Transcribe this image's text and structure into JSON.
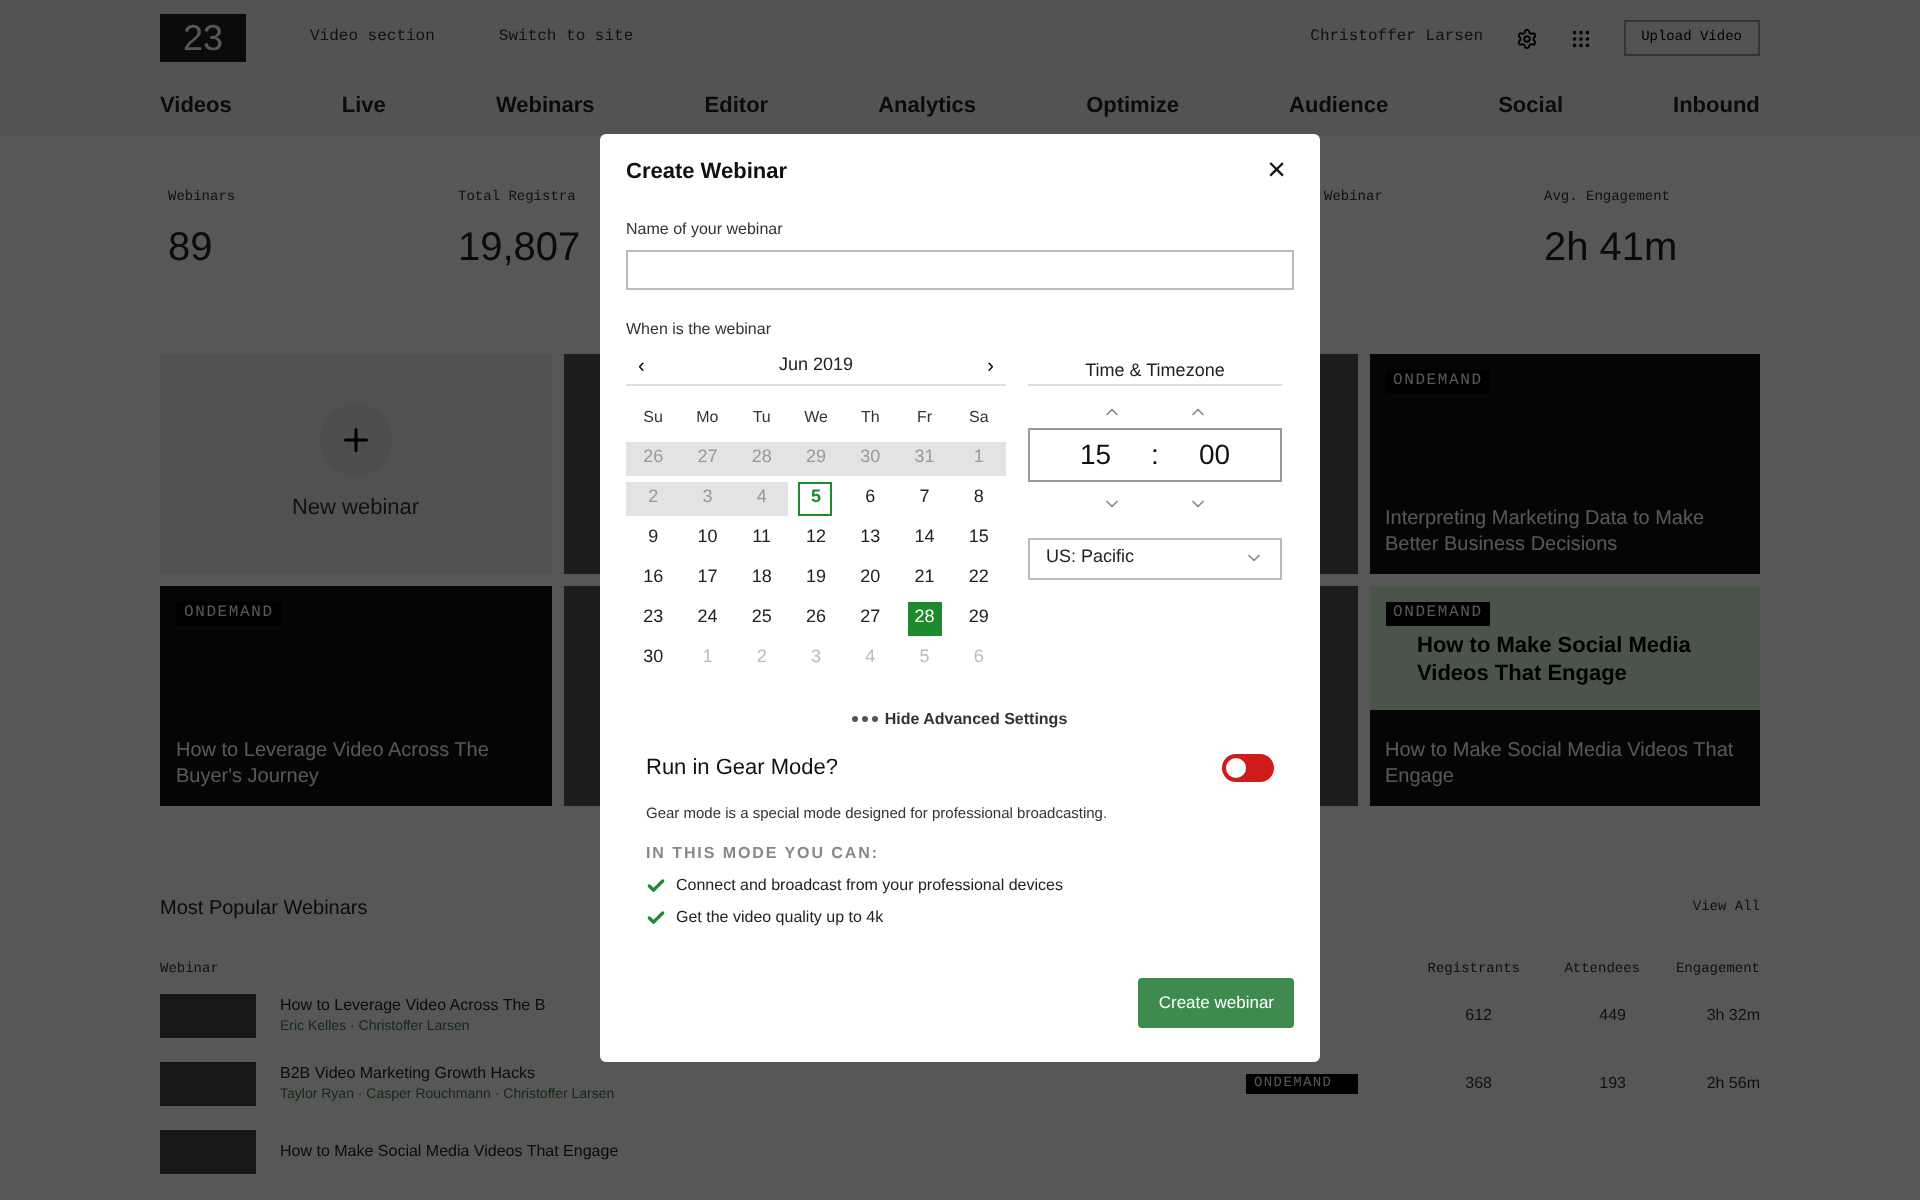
{
  "header": {
    "logo": "23",
    "links": [
      "Video section",
      "Switch to site"
    ],
    "user": "Christoffer Larsen",
    "upload": "Upload Video"
  },
  "nav": [
    "Videos",
    "Live",
    "Webinars",
    "Editor",
    "Analytics",
    "Optimize",
    "Audience",
    "Social",
    "Inbound"
  ],
  "stats": [
    {
      "label": "Webinars",
      "value": "89"
    },
    {
      "label": "Total Registra",
      "value": "19,807"
    },
    {
      "label": "Webinar"
    },
    {
      "label": "Avg. Engagement",
      "value": "2h 41m"
    }
  ],
  "cards": [
    {
      "kind": "new",
      "title": "New webinar"
    },
    {
      "kind": "hidden"
    },
    {
      "kind": "hidden"
    },
    {
      "kind": "video",
      "badge": "ONDEMAND",
      "title": "Interpreting Marketing Data to Make Better Business Decisions"
    },
    {
      "kind": "video",
      "badge": "ONDEMAND",
      "title": "How to Leverage Video Across The Buyer's Journey"
    },
    {
      "kind": "hidden"
    },
    {
      "kind": "hidden"
    },
    {
      "kind": "thumb",
      "badge": "ONDEMAND",
      "thumb_title": "How to Make Social Media Videos That Engage",
      "title": "How to Make Social Media Videos That Engage"
    }
  ],
  "popular": {
    "title": "Most Popular Webinars",
    "view_all": "View All",
    "columns": [
      "Webinar",
      "Registrants",
      "Attendees",
      "Engagement"
    ],
    "rows": [
      {
        "title": "How to Leverage Video Across The B",
        "authors": "Eric Kelles · Christoffer Larsen",
        "registrants": "612",
        "attendees": "449",
        "engagement": "3h 32m"
      },
      {
        "title": "B2B Video Marketing Growth Hacks",
        "authors": "Taylor Ryan · Casper Rouchmann · Christoffer Larsen",
        "badge": "ONDEMAND",
        "registrants": "368",
        "attendees": "193",
        "engagement": "2h 56m"
      },
      {
        "title": "How to Make Social Media Videos That Engage"
      }
    ]
  },
  "modal": {
    "title": "Create Webinar",
    "close": "×",
    "name_label": "Name of your webinar",
    "when_label": "When is the webinar",
    "calendar": {
      "prev": "‹",
      "month": "Jun 2019",
      "next": "›",
      "weekdays": [
        "Su",
        "Mo",
        "Tu",
        "We",
        "Th",
        "Fr",
        "Sa"
      ],
      "weeks": [
        [
          {
            "d": "26",
            "kind": "past",
            "selected": false
          },
          {
            "d": "27",
            "kind": "past",
            "selected": false
          },
          {
            "d": "28",
            "kind": "past",
            "selected": false
          },
          {
            "d": "29",
            "kind": "past",
            "selected": false
          },
          {
            "d": "30",
            "kind": "past",
            "selected": false
          },
          {
            "d": "31",
            "kind": "past",
            "selected": false
          },
          {
            "d": "1",
            "kind": "past",
            "selected": false
          }
        ],
        [
          {
            "d": "2",
            "kind": "past",
            "selected": false
          },
          {
            "d": "3",
            "kind": "past",
            "selected": false
          },
          {
            "d": "4",
            "kind": "past",
            "selected": false
          },
          {
            "d": "5",
            "kind": "today",
            "selected": false
          },
          {
            "d": "6",
            "kind": "day",
            "selected": false
          },
          {
            "d": "7",
            "kind": "day",
            "selected": false
          },
          {
            "d": "8",
            "kind": "day",
            "selected": false
          }
        ],
        [
          {
            "d": "9",
            "kind": "day",
            "selected": false
          },
          {
            "d": "10",
            "kind": "day",
            "selected": false
          },
          {
            "d": "11",
            "kind": "day",
            "selected": false
          },
          {
            "d": "12",
            "kind": "day",
            "selected": false
          },
          {
            "d": "13",
            "kind": "day",
            "selected": false
          },
          {
            "d": "14",
            "kind": "day",
            "selected": false
          },
          {
            "d": "15",
            "kind": "day",
            "selected": false
          }
        ],
        [
          {
            "d": "16",
            "kind": "day",
            "selected": false
          },
          {
            "d": "17",
            "kind": "day",
            "selected": false
          },
          {
            "d": "18",
            "kind": "day",
            "selected": false
          },
          {
            "d": "19",
            "kind": "day",
            "selected": false
          },
          {
            "d": "20",
            "kind": "day",
            "selected": false
          },
          {
            "d": "21",
            "kind": "day",
            "selected": false
          },
          {
            "d": "22",
            "kind": "day",
            "selected": false
          }
        ],
        [
          {
            "d": "23",
            "kind": "day",
            "selected": false
          },
          {
            "d": "24",
            "kind": "day",
            "selected": false
          },
          {
            "d": "25",
            "kind": "day",
            "selected": false
          },
          {
            "d": "26",
            "kind": "day",
            "selected": false
          },
          {
            "d": "27",
            "kind": "day",
            "selected": false
          },
          {
            "d": "28",
            "kind": "day",
            "selected": true
          },
          {
            "d": "29",
            "kind": "day",
            "selected": false
          }
        ],
        [
          {
            "d": "30",
            "kind": "day",
            "selected": false
          },
          {
            "d": "1",
            "kind": "next",
            "selected": false
          },
          {
            "d": "2",
            "kind": "next",
            "selected": false
          },
          {
            "d": "3",
            "kind": "next",
            "selected": false
          },
          {
            "d": "4",
            "kind": "next",
            "selected": false
          },
          {
            "d": "5",
            "kind": "next",
            "selected": false
          },
          {
            "d": "6",
            "kind": "next",
            "selected": false
          }
        ]
      ]
    },
    "time_title": "Time & Timezone",
    "hour": "15",
    "separator": ":",
    "minute": "00",
    "timezone": "US: Pacific",
    "advanced": "Hide Advanced Settings",
    "gear_title": "Run in Gear Mode?",
    "gear_on": false,
    "gear_desc": "Gear mode is a special mode designed for professional broadcasting.",
    "mode_heading": "IN THIS MODE YOU CAN:",
    "features": [
      "Connect and broadcast from your professional devices",
      "Get the video quality up to 4k"
    ],
    "submit": "Create webinar"
  }
}
